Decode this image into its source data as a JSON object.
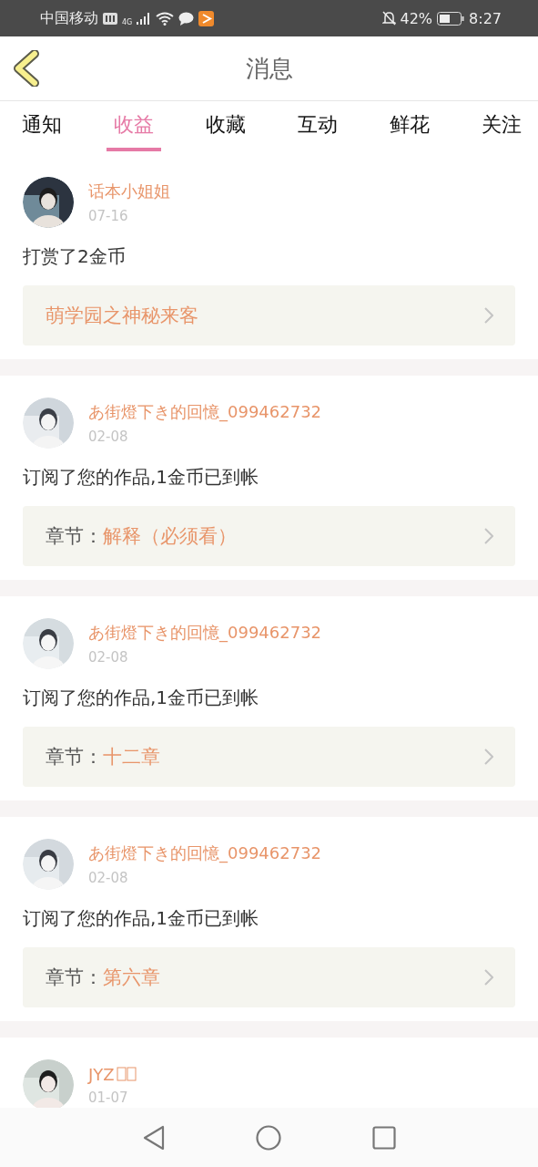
{
  "status_bar": {
    "carrier": "中国移动",
    "network": "4G",
    "battery": "42%",
    "time": "8:27"
  },
  "header": {
    "title": "消息"
  },
  "tabs": [
    {
      "label": "通知",
      "selected": false
    },
    {
      "label": "收益",
      "selected": true
    },
    {
      "label": "收藏",
      "selected": false
    },
    {
      "label": "互动",
      "selected": false
    },
    {
      "label": "鲜花",
      "selected": false
    },
    {
      "label": "关注",
      "selected": false
    }
  ],
  "messages": [
    {
      "user": "话本小姐姐",
      "date": "07-16",
      "text": "打赏了2金币",
      "link": {
        "kind": "book",
        "title": "萌学园之神秘来客"
      }
    },
    {
      "user": "あ街燈下き的回憶_099462732",
      "date": "02-08",
      "text": "订阅了您的作品,1金币已到帐",
      "link": {
        "kind": "chapter",
        "label": "章节：",
        "title": "解释（必须看）"
      }
    },
    {
      "user": "あ街燈下き的回憶_099462732",
      "date": "02-08",
      "text": "订阅了您的作品,1金币已到帐",
      "link": {
        "kind": "chapter",
        "label": "章节：",
        "title": "十二章"
      }
    },
    {
      "user": "あ街燈下き的回憶_099462732",
      "date": "02-08",
      "text": "订阅了您的作品,1金币已到帐",
      "link": {
        "kind": "chapter",
        "label": "章节：",
        "title": "第六章"
      }
    },
    {
      "user": "JYZ",
      "missing_glyphs": true,
      "date": "01-07"
    }
  ]
}
